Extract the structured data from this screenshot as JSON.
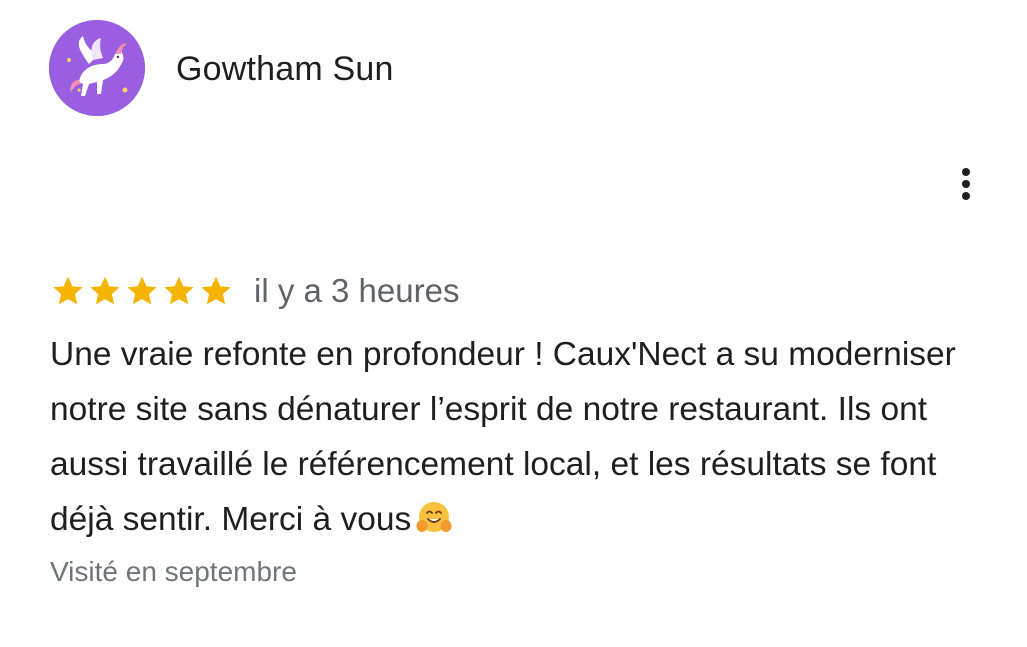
{
  "review": {
    "author_name": "Gowtham Sun",
    "avatar_icon": "pegasus-avatar-icon",
    "more_options_icon": "more-vert-icon",
    "rating": 5,
    "rating_max": 5,
    "time_ago": "il y a 3 heures",
    "text": "Une vraie refonte en profondeur ! Caux'Nect a su moderniser notre site sans dénaturer l’esprit de notre restaurant. Ils ont aussi travaillé le référencement local, et les résultats se font déjà sentir. Merci à vous",
    "text_emoji_icon": "hugging-face-emoji-icon",
    "visited": "Visité en septembre"
  },
  "colors": {
    "star": "#f4b400",
    "avatar_background": "#9a5fe0",
    "secondary_text": "#5f6368"
  }
}
